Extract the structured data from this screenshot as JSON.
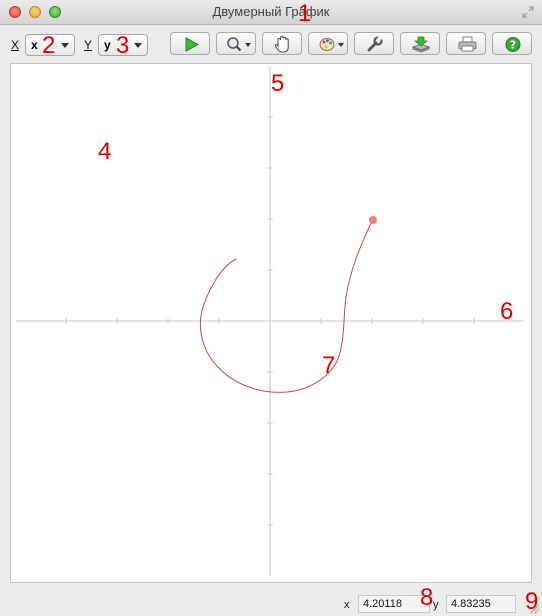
{
  "window": {
    "title": "Двумерный График"
  },
  "toolbar": {
    "x_label": "X",
    "x_value": "x",
    "y_label": "Y",
    "y_value": "y",
    "buttons": [
      "run",
      "zoom",
      "pan",
      "palette",
      "settings",
      "export",
      "print",
      "help"
    ]
  },
  "markers": [
    "1",
    "2",
    "3",
    "4",
    "5",
    "6",
    "7",
    "8",
    "9"
  ],
  "status": {
    "x_label": "x",
    "x_value": "4.20118",
    "y_label": "y",
    "y_value": "4.83235"
  },
  "colors": {
    "curve": "#c24b4b",
    "point": "#f08080",
    "axis": "#c8c8c8",
    "marker": "#e00000",
    "run_icon": "#3cb83c",
    "help_icon": "#3aa83a"
  }
}
